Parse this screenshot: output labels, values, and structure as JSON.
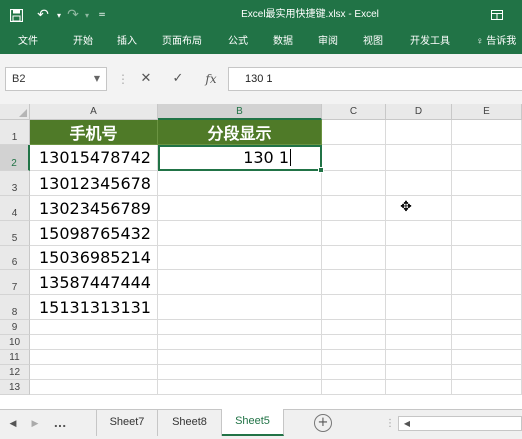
{
  "titlebar": {
    "title": "Excel最实用快捷键.xlsx - Excel",
    "icons": [
      "save-icon",
      "undo-icon",
      "redo-icon",
      "customize-qat-icon",
      "ribbon-display-icon"
    ]
  },
  "ribbon": {
    "tabs": [
      "文件",
      "开始",
      "插入",
      "页面布局",
      "公式",
      "数据",
      "审阅",
      "视图",
      "开发工具"
    ],
    "tell_me": "告诉我"
  },
  "formula_bar": {
    "name_box": "B2",
    "formula": "130 1"
  },
  "columns": [
    "A",
    "B",
    "C",
    "D",
    "E"
  ],
  "rows": [
    "1",
    "2",
    "3",
    "4",
    "5",
    "6",
    "7",
    "8",
    "9",
    "10",
    "11",
    "12",
    "13"
  ],
  "table": {
    "header_a": "手机号",
    "header_b": "分段显示",
    "header_color": "#4f7a28",
    "phones": [
      "13015478742",
      "13012345678",
      "13023456789",
      "15098765432",
      "15036985214",
      "13587447444",
      "15131313131"
    ],
    "edit_value": "130 1"
  },
  "sheet_tabs": {
    "more": "...",
    "tabs": [
      "Sheet7",
      "Sheet8",
      "Sheet5"
    ],
    "active": "Sheet5"
  },
  "accent_color": "#217346"
}
